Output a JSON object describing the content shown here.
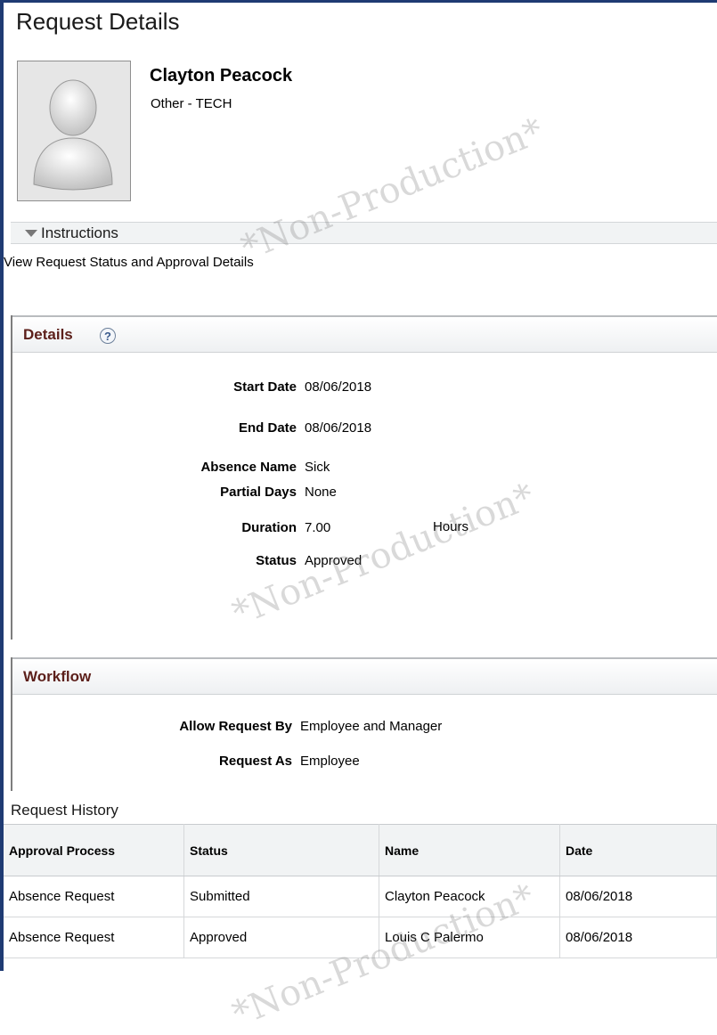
{
  "page_title": "Request Details",
  "employee": {
    "name": "Clayton Peacock",
    "department": "Other - TECH"
  },
  "instructions": {
    "label": "Instructions",
    "text": "View Request Status and Approval Details"
  },
  "details": {
    "title": "Details",
    "help": "?",
    "fields": {
      "start_date": {
        "label": "Start Date",
        "value": "08/06/2018"
      },
      "end_date": {
        "label": "End Date",
        "value": "08/06/2018"
      },
      "absence_name": {
        "label": "Absence Name",
        "value": "Sick"
      },
      "partial_days": {
        "label": "Partial Days",
        "value": "None"
      },
      "duration": {
        "label": "Duration",
        "value": "7.00",
        "unit": "Hours"
      },
      "status": {
        "label": "Status",
        "value": "Approved"
      }
    }
  },
  "workflow": {
    "title": "Workflow",
    "fields": {
      "allow_request_by": {
        "label": "Allow Request By",
        "value": "Employee and Manager"
      },
      "request_as": {
        "label": "Request As",
        "value": "Employee"
      }
    }
  },
  "request_history": {
    "title": "Request History",
    "columns": [
      "Approval Process",
      "Status",
      "Name",
      "Date"
    ],
    "rows": [
      [
        "Absence Request",
        "Submitted",
        "Clayton Peacock",
        "08/06/2018"
      ],
      [
        "Absence Request",
        "Approved",
        "Louis C Palermo",
        "08/06/2018"
      ]
    ]
  },
  "watermark": "*Non-Production*",
  "colors": {
    "frame": "#1f3b73",
    "section_title": "#5c1f1a"
  }
}
